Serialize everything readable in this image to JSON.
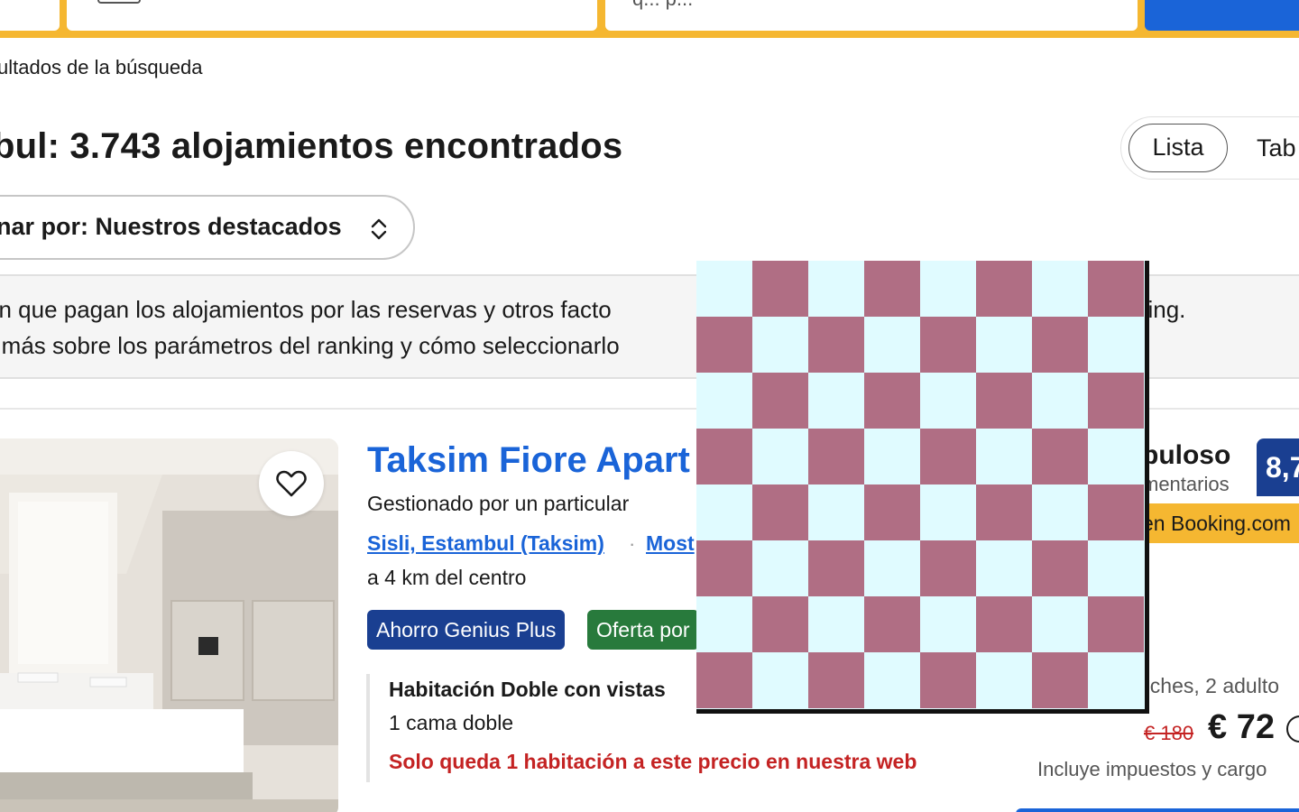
{
  "search": {
    "partial_field_text": "q... p..."
  },
  "breadcrumb": {
    "text": "ultados de la búsqueda"
  },
  "results": {
    "heading": "bul: 3.743 alojamientos encontrados"
  },
  "view_toggle": {
    "list_label": "Lista",
    "table_label": "Tab"
  },
  "sort": {
    "label": "nar por: Nuestros destacados"
  },
  "info": {
    "line1": "ón que pagan los alojamientos por las reservas y otros facto",
    "line1_end": "nking.",
    "line2": "e más sobre los parámetros del ranking y cómo seleccionarlo"
  },
  "property": {
    "title": "Taksim Fiore Apart",
    "managed_by": "Gestionado por un particular",
    "location_link": "Sisli, Estambul (Taksim)",
    "location_sep": "·",
    "map_link": "Most",
    "distance": "a 4 km del centro",
    "badges": {
      "genius": "Ahorro Genius Plus",
      "offer": "Oferta por"
    },
    "room": {
      "title": "Habitación Doble con vistas",
      "bed": "1 cama doble",
      "scarcity": "Solo queda 1 habitación a este precio en nuestra web"
    },
    "review": {
      "word": "buloso",
      "count": "mentarios",
      "score": "8,7",
      "tag": "en Booking.com"
    },
    "price": {
      "nights": "oches, 2 adulto",
      "old": "€ 180",
      "current": "€ 72",
      "taxes": "Incluye impuestos y cargo"
    }
  },
  "colors": {
    "brand_blue": "#1a64d8",
    "navy": "#1a3f91",
    "yellow": "#f5b731",
    "green": "#287a3c",
    "red": "#c42323",
    "checker_light": "#e0fbff",
    "checker_dark": "#b06e84"
  },
  "icons": [
    "search-icon",
    "heart-icon",
    "sort-updown-icon",
    "info-icon"
  ]
}
